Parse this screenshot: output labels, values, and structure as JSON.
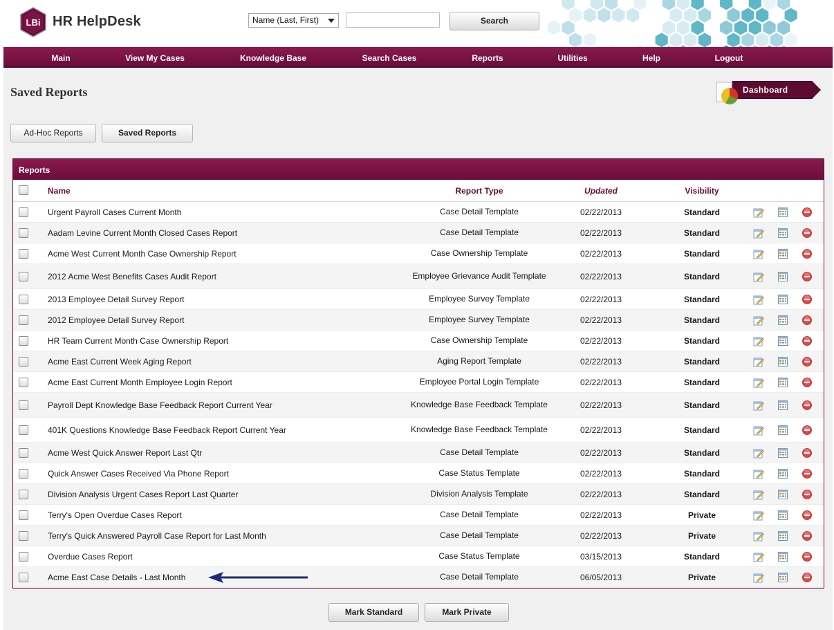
{
  "header": {
    "logo_text": "LBi",
    "app_title": "HR HelpDesk",
    "search_field_select": "Name (Last, First)",
    "search_input_value": "",
    "search_button": "Search"
  },
  "nav": [
    {
      "label": "Main"
    },
    {
      "label": "View My Cases"
    },
    {
      "label": "Knowledge Base"
    },
    {
      "label": "Search Cases"
    },
    {
      "label": "Reports"
    },
    {
      "label": "Utilities"
    },
    {
      "label": "Help"
    },
    {
      "label": "Logout"
    }
  ],
  "page": {
    "title": "Saved Reports",
    "dashboard_button": "Dashboard",
    "tabs": [
      "Ad-Hoc Reports",
      "Saved Reports"
    ]
  },
  "table": {
    "panel_title": "Reports",
    "headers": {
      "name": "Name",
      "type": "Report Type",
      "updated": "Updated",
      "visibility": "Visibility"
    },
    "rows": [
      {
        "name": "Urgent Payroll Cases Current Month",
        "type": "Case Detail Template",
        "updated": "02/22/2013",
        "visibility": "Standard"
      },
      {
        "name": "Aadam Levine Current Month Closed Cases Report",
        "type": "Case Detail Template",
        "updated": "02/22/2013",
        "visibility": "Standard"
      },
      {
        "name": "Acme West Current Month Case Ownership Report",
        "type": "Case Ownership Template",
        "updated": "02/22/2013",
        "visibility": "Standard"
      },
      {
        "name": "2012 Acme West Benefits Cases Audit Report",
        "type": "Employee Grievance Audit Template",
        "updated": "02/22/2013",
        "visibility": "Standard"
      },
      {
        "name": "2013 Employee Detail Survey Report",
        "type": "Employee Survey Template",
        "updated": "02/22/2013",
        "visibility": "Standard"
      },
      {
        "name": "2012 Employee Detail Survey Report",
        "type": "Employee Survey Template",
        "updated": "02/22/2013",
        "visibility": "Standard"
      },
      {
        "name": "HR Team Current Month Case Ownership Report",
        "type": "Case Ownership Template",
        "updated": "02/22/2013",
        "visibility": "Standard"
      },
      {
        "name": "Acme East Current Week Aging Report",
        "type": "Aging Report Template",
        "updated": "02/22/2013",
        "visibility": "Standard"
      },
      {
        "name": "Acme East Current Month Employee Login Report",
        "type": "Employee Portal Login Template",
        "updated": "02/22/2013",
        "visibility": "Standard"
      },
      {
        "name": "Payroll Dept Knowledge Base Feedback Report Current Year",
        "type": "Knowledge Base Feedback Template",
        "updated": "02/22/2013",
        "visibility": "Standard"
      },
      {
        "name": "401K Questions Knowledge Base Feedback Report Current Year",
        "type": "Knowledge Base Feedback Template",
        "updated": "02/22/2013",
        "visibility": "Standard"
      },
      {
        "name": "Acme West Quick Answer Report Last Qtr",
        "type": "Case Detail Template",
        "updated": "02/22/2013",
        "visibility": "Standard"
      },
      {
        "name": "Quick Answer Cases Received Via Phone Report",
        "type": "Case Status Template",
        "updated": "02/22/2013",
        "visibility": "Standard"
      },
      {
        "name": "Division Analysis Urgent Cases Report Last Quarter",
        "type": "Division Analysis Template",
        "updated": "02/22/2013",
        "visibility": "Standard"
      },
      {
        "name": "Terry's Open Overdue Cases Report",
        "type": "Case Detail Template",
        "updated": "02/22/2013",
        "visibility": "Private"
      },
      {
        "name": "Terry's Quick Answered Payroll Case Report for Last Month",
        "type": "Case Detail Template",
        "updated": "02/22/2013",
        "visibility": "Private"
      },
      {
        "name": "Overdue Cases Report",
        "type": "Case Status Template",
        "updated": "03/15/2013",
        "visibility": "Standard"
      },
      {
        "name": "Acme East Case Details - Last Month",
        "type": "Case Detail Template",
        "updated": "06/05/2013",
        "visibility": "Private"
      }
    ]
  },
  "actions": {
    "mark_standard": "Mark Standard",
    "mark_private": "Mark Private"
  },
  "colors": {
    "brand": "#6a0d39",
    "nav_gradient_top": "#8b1a4f",
    "content_bg": "#f0f0f0",
    "arrow": "#1f2a78"
  }
}
